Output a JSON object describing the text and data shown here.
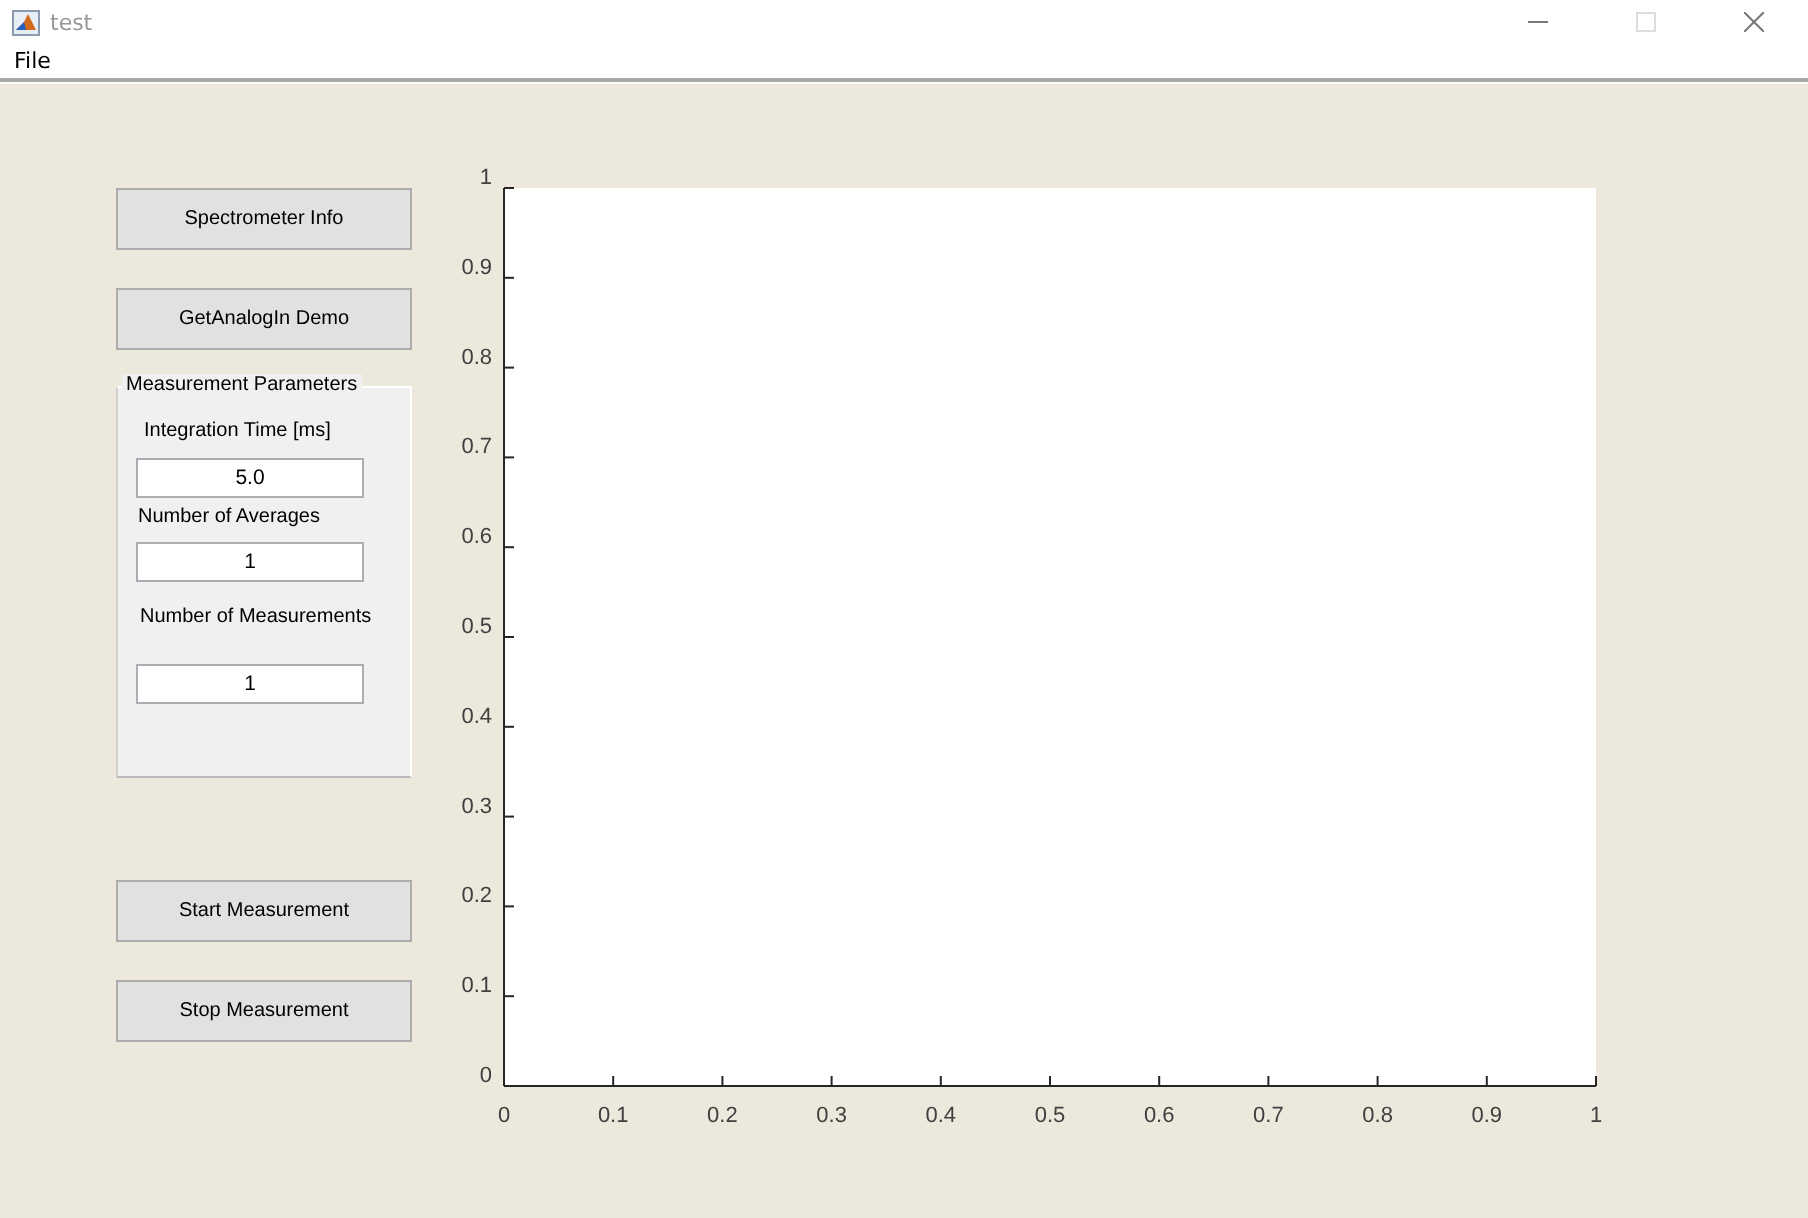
{
  "window": {
    "title": "test"
  },
  "menu": [
    "File"
  ],
  "buttons_top": [
    "Spectrometer Info",
    "GetAnalogIn Demo"
  ],
  "panel": {
    "title": "Measurement Parameters",
    "fields": [
      {
        "label": "Integration Time [ms]",
        "value": "5.0"
      },
      {
        "label": "Number of Averages",
        "value": "1"
      },
      {
        "label": "Number of Measurements",
        "value": "1"
      }
    ]
  },
  "buttons_bottom": [
    "Start Measurement",
    "Stop Measurement"
  ],
  "axes": {
    "chart_data": {
      "type": "line",
      "xlim": [
        0,
        1
      ],
      "ylim": [
        0,
        1
      ],
      "xticks": [
        0,
        0.1,
        0.2,
        0.3,
        0.4,
        0.5,
        0.6,
        0.7,
        0.8,
        0.9,
        1
      ],
      "yticks": [
        0,
        0.1,
        0.2,
        0.3,
        0.4,
        0.5,
        0.6,
        0.7,
        0.8,
        0.9,
        1
      ]
    }
  }
}
